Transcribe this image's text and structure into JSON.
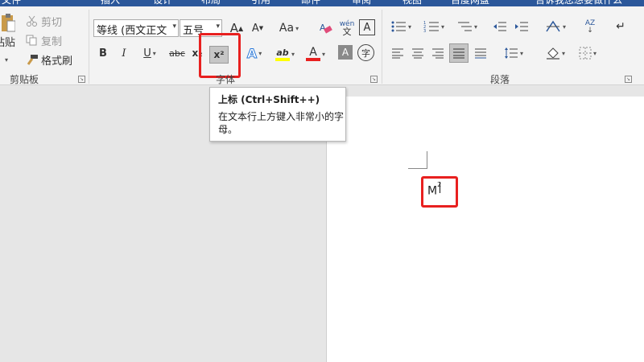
{
  "tabs": {
    "file": "文件",
    "home": "开始",
    "insert": "插入",
    "design": "设计",
    "layout": "布局",
    "references": "引用",
    "mailings": "邮件",
    "review": "审阅",
    "view": "视图",
    "team": "百度网盘",
    "tell_me": "告诉我您想要做什么"
  },
  "clipboard": {
    "paste": "粘贴",
    "cut": "剪切",
    "copy": "复制",
    "format_painter": "格式刷",
    "group_label": "剪贴板"
  },
  "font": {
    "font_name": "等线 (西文正文",
    "font_size": "五号",
    "grow": "A",
    "shrink": "A",
    "case": "Aa",
    "phonetic": "wén",
    "phonetic_sub": "文",
    "char_border": "A",
    "bold": "B",
    "italic": "I",
    "underline": "U",
    "strike": "abc",
    "subscript": "x₂",
    "superscript": "x²",
    "text_effects": "A",
    "highlight": "ab",
    "font_color": "A",
    "char_shading": "A",
    "enclose": "字",
    "group_label": "字体"
  },
  "paragraph": {
    "group_label": "段落",
    "sort": "AZ"
  },
  "tooltip": {
    "title": "上标 (Ctrl+Shift++)",
    "body": "在文本行上方键入非常小的字母。"
  },
  "document": {
    "text": "M",
    "sup": "2"
  },
  "colors": {
    "accent": "#2b579a",
    "annotation": "#e8201f",
    "highlight_yellow": "#ffff00",
    "font_red": "#e8201f"
  }
}
